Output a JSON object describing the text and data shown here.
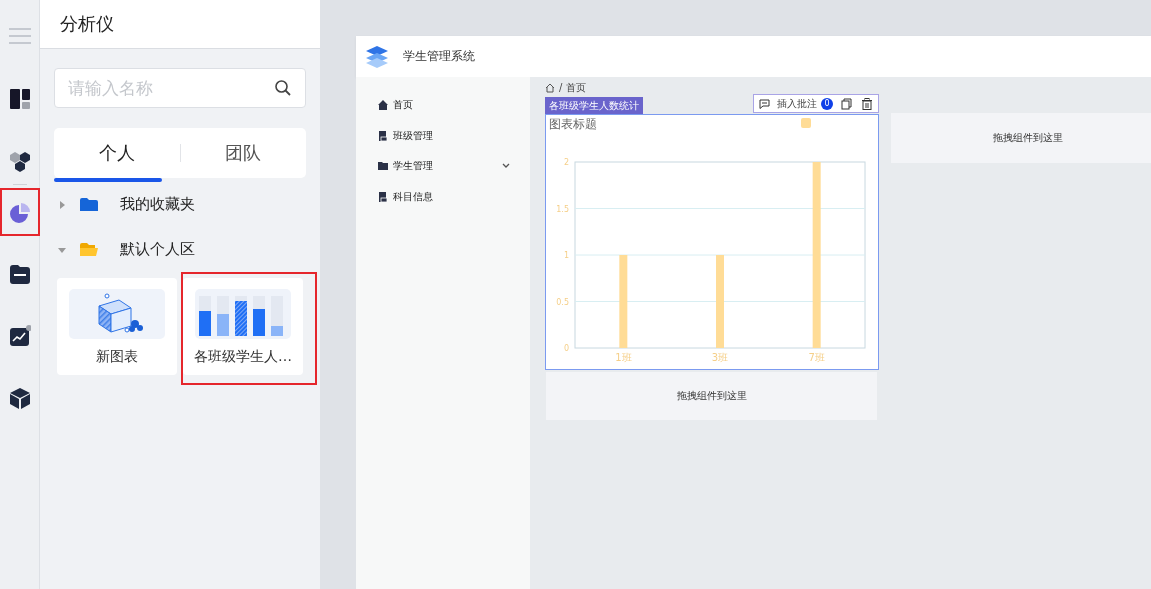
{
  "sidebar_rail": {
    "items": [
      {
        "selected": false
      },
      {
        "selected": false
      },
      {
        "selected": true
      },
      {
        "selected": false
      },
      {
        "selected": false
      },
      {
        "selected": false
      }
    ]
  },
  "panel": {
    "title": "分析仪",
    "search": {
      "placeholder": "请输入名称"
    },
    "tabs": [
      {
        "label": "个人",
        "selected": true
      },
      {
        "label": "团队",
        "selected": false
      }
    ],
    "tree": [
      {
        "label": "我的收藏夹",
        "expanded": false
      },
      {
        "label": "默认个人区",
        "expanded": true
      }
    ],
    "cards": [
      {
        "label": "新图表",
        "selected": false
      },
      {
        "label": "各班级学生人…",
        "selected": true
      }
    ]
  },
  "preview": {
    "app_title": "学生管理系统",
    "menu": [
      {
        "label": "首页"
      },
      {
        "label": "班级管理"
      },
      {
        "label": "学生管理",
        "expanded": false,
        "submenu": true
      },
      {
        "label": "科目信息"
      }
    ],
    "breadcrumb": {
      "separator": "/",
      "current": "首页"
    },
    "component": {
      "label": "各班级学生人数统计",
      "toolbar": {
        "comment": "插入批注",
        "count": "0"
      },
      "chart_data": {
        "type": "bar",
        "title": "图表标题",
        "categories": [
          "1班",
          "3班",
          "7班"
        ],
        "series": [
          {
            "color": "#ffdc96",
            "values": [
              1,
              1,
              2
            ]
          }
        ],
        "ylim": [
          0,
          2
        ],
        "yticks": [
          0,
          0.5,
          1,
          1.5,
          2
        ],
        "grid": true
      }
    },
    "drop_zones": [
      "拖拽组件到这里",
      "拖拽组件到这里"
    ]
  }
}
